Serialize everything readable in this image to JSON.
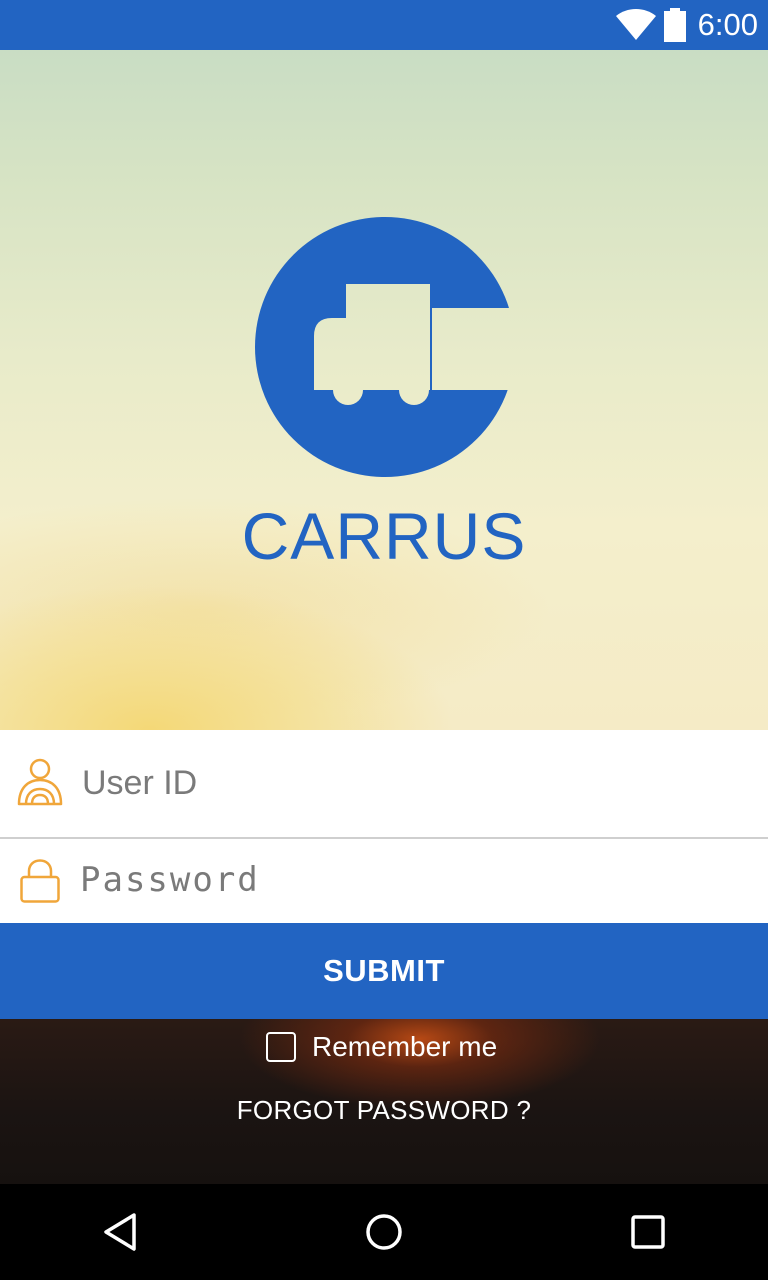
{
  "status_bar": {
    "time": "6:00",
    "icons": [
      "wifi-icon",
      "battery-icon"
    ],
    "color": "#2264c2"
  },
  "app": {
    "brand_name": "CARRUS",
    "logo_icon": "truck-logo-icon",
    "brand_color": "#2264c2"
  },
  "login_form": {
    "user_id": {
      "placeholder": "User ID",
      "value": "",
      "icon": "driver-user-icon"
    },
    "password": {
      "placeholder": "Password",
      "value": "",
      "icon": "lock-icon"
    },
    "submit_label": "SUBMIT",
    "remember_me": {
      "label": "Remember me",
      "checked": false
    },
    "forgot_password_label": "FORGOT PASSWORD ?"
  },
  "nav_bar": {
    "buttons": [
      "back-icon",
      "home-icon",
      "recents-icon"
    ]
  },
  "colors": {
    "accent_orange": "#f0a63a",
    "text_placeholder": "#7a7a7a"
  }
}
